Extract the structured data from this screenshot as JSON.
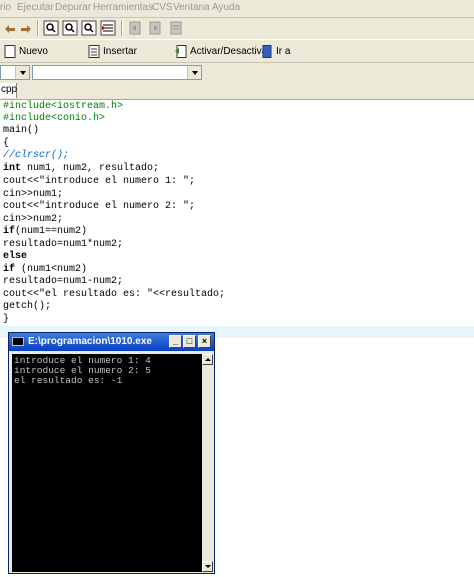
{
  "menu": [
    "rio",
    "Ejecutar",
    "Depurar",
    "Herramientas",
    "CVS",
    "Ventana",
    "Ayuda"
  ],
  "toolbar": {
    "icons": [
      "undo-icon",
      "redo-icon",
      "find-icon",
      "find-next-icon",
      "replace-icon",
      "goto-line-icon",
      "back-icon",
      "forward-icon",
      "stop-icon"
    ]
  },
  "toolbar2": {
    "nuevo": "Nuevo",
    "insertar": "Insertar",
    "activar": "Activar/Desactivar",
    "ir_a": "Ir a"
  },
  "tab": {
    "label": "cpp"
  },
  "code": [
    "#include<iostream.h>",
    "#include<conio.h>",
    "main()",
    "{",
    "//clrscr();",
    "int num1, num2, resultado;",
    "cout<<\"introduce el numero 1: \";",
    "cin>>num1;",
    "cout<<\"introduce el numero 2: \";",
    "cin>>num2;",
    "if(num1==num2)",
    "resultado=num1*num2;",
    "else",
    "if (num1<num2)",
    "resultado=num1-num2;",
    "cout<<\"el resultado es: \"<<resultado;",
    "getch();",
    "}"
  ],
  "console": {
    "title": "E:\\programacion\\1010.exe",
    "lines": [
      "introduce el numero 1: 4",
      "introduce el numero 2: 5",
      "el resultado es: -1"
    ]
  }
}
